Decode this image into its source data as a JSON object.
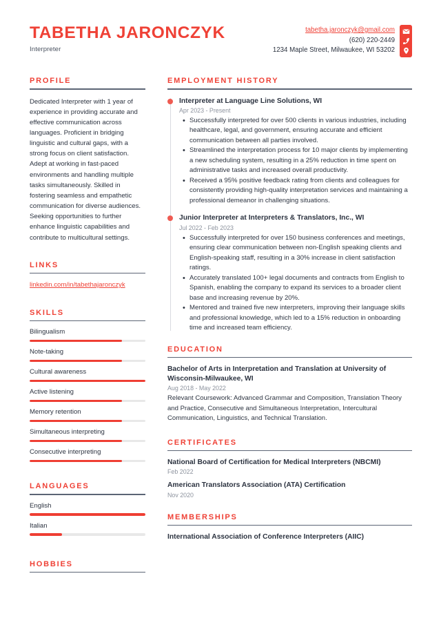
{
  "header": {
    "name": "TABETHA JARONCZYK",
    "job_title": "Interpreter",
    "email": "tabetha.jaronczyk@gmail.com",
    "phone": "(620) 220-2449",
    "address": "1234 Maple Street, Milwaukee, WI 53202",
    "icons": [
      "envelope-icon",
      "phone-icon",
      "location-pin-icon"
    ],
    "accent_color": "#ef4136",
    "text_color": "#2c3340"
  },
  "left": {
    "profile": {
      "heading": "PROFILE",
      "text": "Dedicated Interpreter with 1 year of experience in providing accurate and effective communication across languages. Proficient in bridging linguistic and cultural gaps, with a strong focus on client satisfaction. Adept at working in fast-paced environments and handling multiple tasks simultaneously. Skilled in fostering seamless and empathetic communication for diverse audiences. Seeking opportunities to further enhance linguistic capabilities and contribute to multicultural settings."
    },
    "links": {
      "heading": "LINKS",
      "items": [
        {
          "label": "linkedin.com/in/tabethajaronczyk"
        }
      ]
    },
    "skills": {
      "heading": "SKILLS",
      "items": [
        {
          "label": "Bilingualism",
          "level": 80
        },
        {
          "label": "Note-taking",
          "level": 80
        },
        {
          "label": "Cultural awareness",
          "level": 100
        },
        {
          "label": "Active listening",
          "level": 80
        },
        {
          "label": "Memory retention",
          "level": 80
        },
        {
          "label": "Simultaneous interpreting",
          "level": 80
        },
        {
          "label": "Consecutive interpreting",
          "level": 80
        }
      ]
    },
    "languages": {
      "heading": "LANGUAGES",
      "items": [
        {
          "label": "English",
          "level": 100
        },
        {
          "label": "Italian",
          "level": 28
        }
      ]
    },
    "hobbies": {
      "heading": "HOBBIES"
    }
  },
  "right": {
    "employment": {
      "heading": "EMPLOYMENT HISTORY",
      "jobs": [
        {
          "title": "Interpreter at Language Line Solutions, WI",
          "date": "Apr 2023 - Present",
          "bullets": [
            "Successfully interpreted for over 500 clients in various industries, including healthcare, legal, and government, ensuring accurate and efficient communication between all parties involved.",
            "Streamlined the interpretation process for 10 major clients by implementing a new scheduling system, resulting in a 25% reduction in time spent on administrative tasks and increased overall productivity.",
            "Received a 95% positive feedback rating from clients and colleagues for consistently providing high-quality interpretation services and maintaining a professional demeanor in challenging situations."
          ]
        },
        {
          "title": "Junior Interpreter at Interpreters & Translators, Inc., WI",
          "date": "Jul 2022 - Feb 2023",
          "bullets": [
            "Successfully interpreted for over 150 business conferences and meetings, ensuring clear communication between non-English speaking clients and English-speaking staff, resulting in a 30% increase in client satisfaction ratings.",
            "Accurately translated 100+ legal documents and contracts from English to Spanish, enabling the company to expand its services to a broader client base and increasing revenue by 20%.",
            "Mentored and trained five new interpreters, improving their language skills and professional knowledge, which led to a 15% reduction in onboarding time and increased team efficiency."
          ]
        }
      ]
    },
    "education": {
      "heading": "EDUCATION",
      "entries": [
        {
          "title": "Bachelor of Arts in Interpretation and Translation at University of Wisconsin-Milwaukee, WI",
          "date": "Aug 2018 - May 2022",
          "description": "Relevant Coursework: Advanced Grammar and Composition, Translation Theory and Practice, Consecutive and Simultaneous Interpretation, Intercultural Communication, Linguistics, and Technical Translation."
        }
      ]
    },
    "certificates": {
      "heading": "CERTIFICATES",
      "entries": [
        {
          "title": "National Board of Certification for Medical Interpreters (NBCMI)",
          "date": "Feb 2022"
        },
        {
          "title": "American Translators Association (ATA) Certification",
          "date": "Nov 2020"
        }
      ]
    },
    "memberships": {
      "heading": "MEMBERSHIPS",
      "entries": [
        {
          "title": "International Association of Conference Interpreters (AIIC)"
        }
      ]
    }
  }
}
